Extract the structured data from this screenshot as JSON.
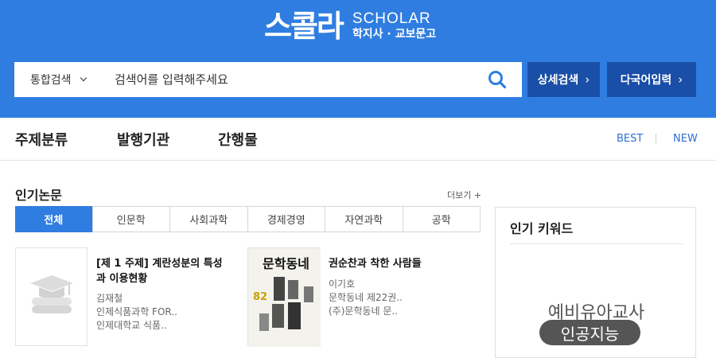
{
  "brand": {
    "logo_korean": "스콜라",
    "logo_english": "SCHOLAR",
    "logo_sub": "학지사 · 교보문고",
    "primary_color": "#2f7de1",
    "dark_button_color": "#1a4fa8"
  },
  "search": {
    "category": "통합검색",
    "placeholder": "검색어를 입력해주세요",
    "detail_button": "상세검색",
    "lang_button": "다국어입력"
  },
  "nav": {
    "items": [
      "주제분류",
      "발행기관",
      "간행물"
    ],
    "best": "BEST",
    "new": "NEW"
  },
  "popular_papers": {
    "title": "인기논문",
    "more": "더보기 +",
    "tabs": [
      "전체",
      "인문학",
      "사회과학",
      "경제경영",
      "자연과학",
      "공학"
    ],
    "active_tab": "전체",
    "cards": [
      {
        "thumb_icon": "graduation-cap-book-icon",
        "title": "[제 1 주제] 계란성분의 특성과 이용현황",
        "author": "김재철",
        "journal": "인제식품과학 FOR..",
        "publisher": "인제대학교 식품.."
      },
      {
        "cover_title": "문학동네",
        "cover_number": "82",
        "title": "권순찬과 착한 사람들",
        "author": "이기호",
        "journal": "문학동네 제22권..",
        "publisher": "(주)문학동네 문.."
      }
    ]
  },
  "keywords": {
    "title": "인기 키워드",
    "items": [
      "예비유아교사",
      "인공지능"
    ]
  }
}
